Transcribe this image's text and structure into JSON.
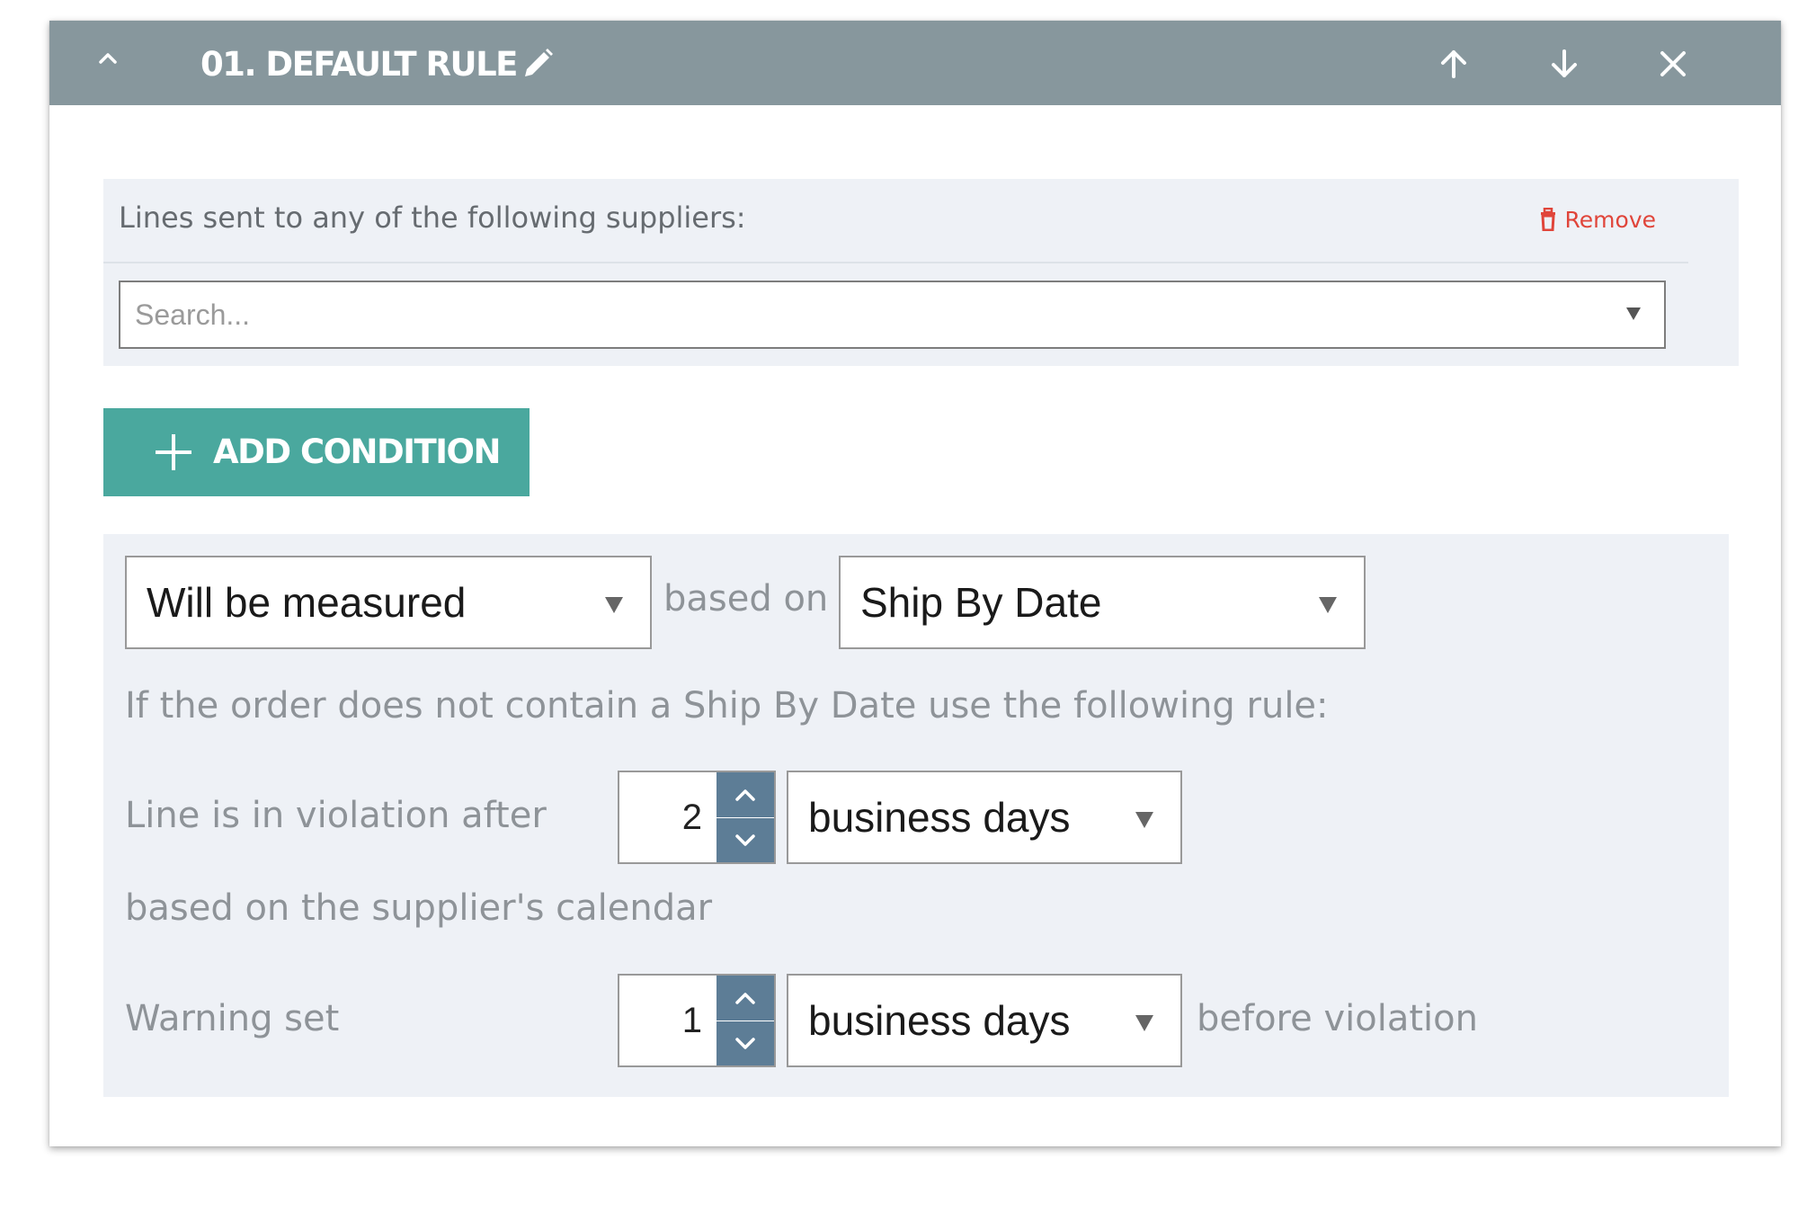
{
  "rule": {
    "title": "01. DEFAULT RULE",
    "icons": {
      "collapse": "chevron-up-icon",
      "edit": "pencil-icon",
      "move_up": "arrow-up-icon",
      "move_down": "arrow-down-icon",
      "close": "close-icon"
    }
  },
  "suppliers": {
    "label": "Lines sent to any of the following suppliers:",
    "remove_label": "Remove",
    "search_placeholder": "Search..."
  },
  "add_condition": {
    "label": "ADD CONDITION"
  },
  "measure": {
    "mode_value": "Will be measured",
    "based_on_label": "based on",
    "date_field_value": "Ship By Date",
    "fallback_text": "If the order does not contain a Ship By Date use the following rule:",
    "violation_label": "Line is in violation after",
    "violation_amount": "2",
    "violation_unit": "business days",
    "calendar_text": "based on the supplier's calendar",
    "warning_label": "Warning set",
    "warning_amount": "1",
    "warning_unit": "business days",
    "before_violation_text": "before violation"
  },
  "colors": {
    "header_bg": "#87979d",
    "accent": "#4aa89e",
    "stepper": "#5d7d96",
    "remove": "#e0453a",
    "panel_bg": "#eef1f6"
  }
}
